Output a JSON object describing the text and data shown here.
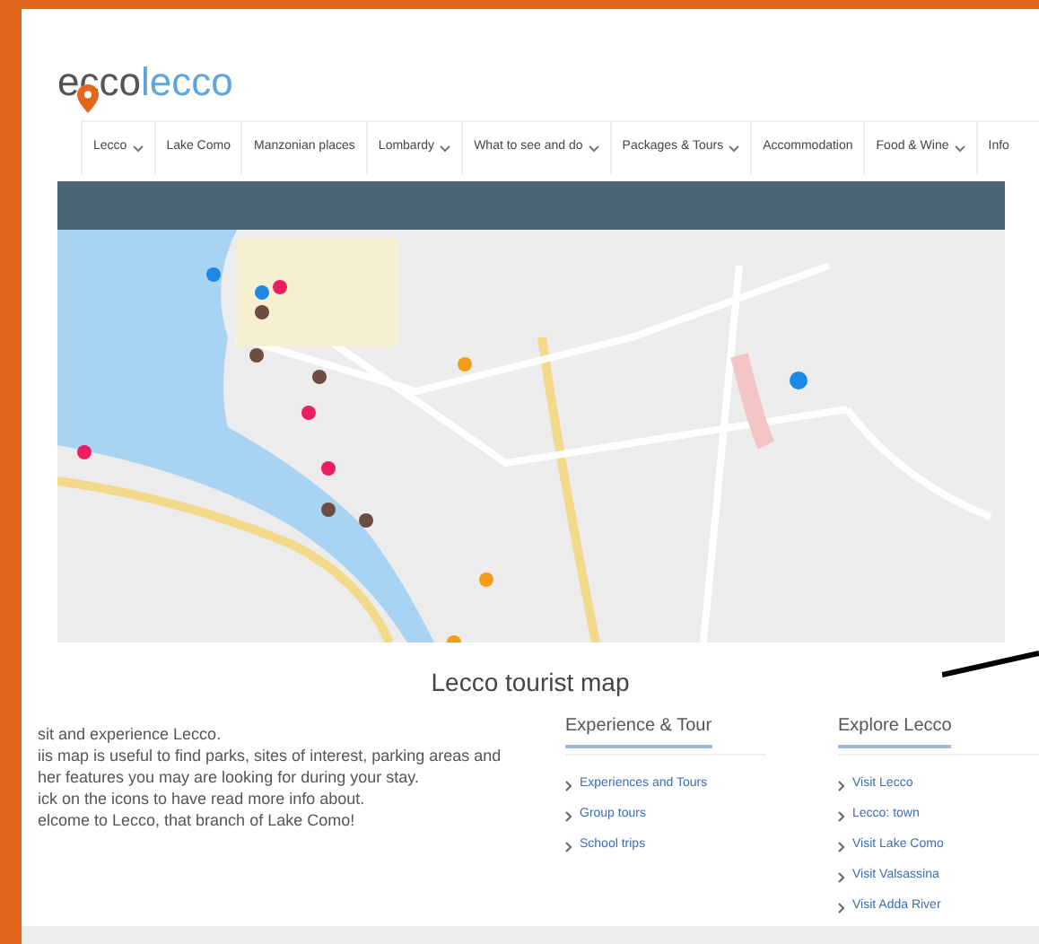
{
  "logo": {
    "part_1": "ecco",
    "part_2": "lecco"
  },
  "nav": [
    {
      "label": "Lecco",
      "dropdown": true
    },
    {
      "label": "Lake Como",
      "dropdown": false
    },
    {
      "label": "Manzonian places",
      "dropdown": false
    },
    {
      "label": "Lombardy",
      "dropdown": true
    },
    {
      "label": "What to see and do",
      "dropdown": true
    },
    {
      "label": "Packages & Tours",
      "dropdown": true
    },
    {
      "label": "Accommodation",
      "dropdown": false
    },
    {
      "label": "Food & Wine",
      "dropdown": true
    },
    {
      "label": "Info",
      "dropdown": false
    }
  ],
  "map_title": "Lecco tourist map",
  "intro_lines": [
    "sit and experience Lecco.",
    "iis map is useful to find parks, sites of interest, parking areas and",
    "her features you may are looking for during your stay.",
    "ick on the icons to have read more info about.",
    "elcome to Lecco, that branch of Lake Como!"
  ],
  "link_columns": [
    {
      "heading": "Experience & Tour",
      "links": [
        "Experiences and Tours",
        "Group tours",
        "School trips"
      ]
    },
    {
      "heading": "Explore Lecco",
      "links": [
        "Visit Lecco",
        "Lecco: town",
        "Visit Lake Como",
        "Visit Valsassina",
        "Visit Adda River"
      ]
    }
  ]
}
